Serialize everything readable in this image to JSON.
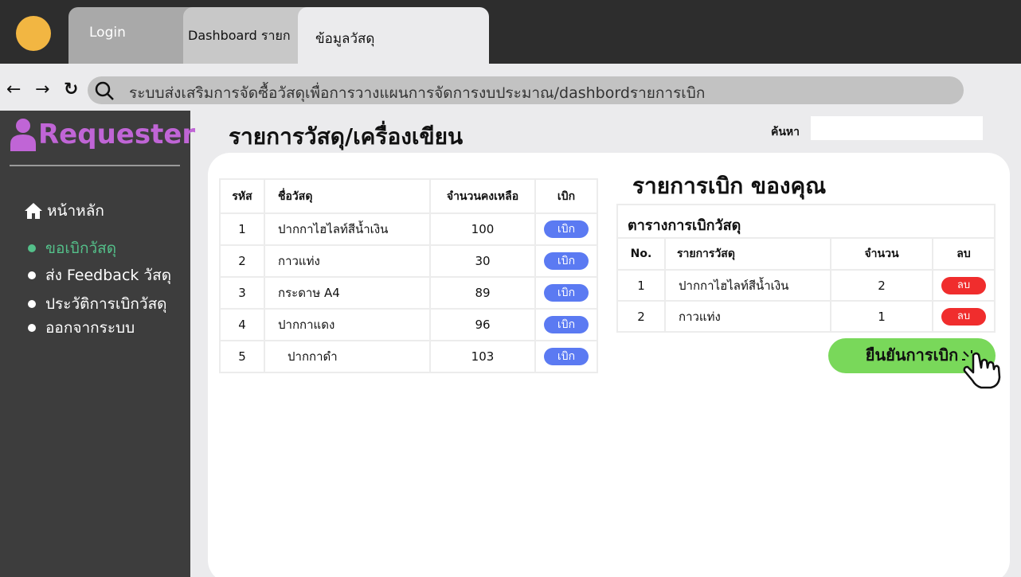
{
  "browser": {
    "tabs": [
      {
        "label": "Login"
      },
      {
        "label": "Dashboard รายก"
      },
      {
        "label": "ข้อมูลวัสดุ"
      }
    ],
    "nav": {
      "back": "←",
      "forward": "→",
      "reload": "↻"
    },
    "url": "ระบบส่งเสริมการจัดซื้อวัสดุเพื่อการวางแผนการจัดการงบประมาณ/dashbordรายการเบิก"
  },
  "sidebar": {
    "role": "Requester",
    "home": "หน้าหลัก",
    "items": [
      {
        "label": "ขอเบิกวัสดุ"
      },
      {
        "label": "ส่ง Feedback วัสดุ"
      },
      {
        "label": "ประวัติการเบิกวัสดุ"
      },
      {
        "label": "ออกจากระบบ"
      }
    ]
  },
  "main": {
    "title": "รายการวัสดุ/เครื่องเขียน",
    "search_label": "ค้นหา",
    "search_value": ""
  },
  "stock_table": {
    "headers": [
      "รหัส",
      "ชื่อวัสดุ",
      "จำนวนคงเหลือ",
      "เบิก"
    ],
    "rows": [
      {
        "code": "1",
        "name": "ปากกาไฮไลท์สีน้ำเงิน",
        "qty": "100",
        "action": "เบิก"
      },
      {
        "code": "2",
        "name": "กาวแท่ง",
        "qty": "30",
        "action": "เบิก"
      },
      {
        "code": "3",
        "name": "กระดาษ A4",
        "qty": "89",
        "action": "เบิก"
      },
      {
        "code": "4",
        "name": "ปากกาแดง",
        "qty": "96",
        "action": "เบิก"
      },
      {
        "code": "5",
        "name": "ปากกาดำ",
        "qty": "103",
        "action": "เบิก"
      }
    ]
  },
  "request": {
    "title": "รายการเบิก ของคุณ",
    "table_title": "ตารางการเบิกวัสดุ",
    "headers": [
      "No.",
      "รายการวัสดุ",
      "จำนวน",
      "ลบ"
    ],
    "rows": [
      {
        "no": "1",
        "item": "ปากกาไฮไลท์สีน้ำเงิน",
        "qty": "2",
        "action": "ลบ"
      },
      {
        "no": "2",
        "item": "กาวแท่ง",
        "qty": "1",
        "action": "ลบ"
      }
    ],
    "confirm_label": "ยืนยันการเบิก"
  },
  "colors": {
    "accent_purple": "#c065d6",
    "active_green": "#54c08a",
    "issue_blue": "#5b7af2",
    "delete_red": "#f02d2d",
    "confirm_green": "#79d85a",
    "brand_dot": "#f2b642"
  }
}
